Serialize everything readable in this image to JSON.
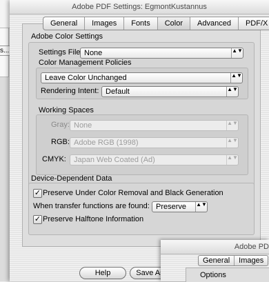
{
  "background": {
    "button_label": "s..."
  },
  "dialog": {
    "title": "Adobe PDF Settings: EgmontKustannus",
    "tabs": [
      {
        "label": "General"
      },
      {
        "label": "Images"
      },
      {
        "label": "Fonts"
      },
      {
        "label": "Color"
      },
      {
        "label": "Advanced"
      },
      {
        "label": "PDF/X"
      }
    ],
    "active_tab": "Color"
  },
  "color_settings": {
    "section_title": "Adobe Color Settings",
    "settings_file_label": "Settings File:",
    "settings_file_value": "None",
    "management_title": "Color Management Policies",
    "policy_value": "Leave Color Unchanged",
    "rendering_intent_label": "Rendering Intent:",
    "rendering_intent_value": "Default",
    "working_spaces_title": "Working Spaces",
    "gray_label": "Gray:",
    "gray_value": "None",
    "rgb_label": "RGB:",
    "rgb_value": "Adobe RGB (1998)",
    "cmyk_label": "CMYK:",
    "cmyk_value": "Japan Web Coated (Ad)"
  },
  "device_data": {
    "section_title": "Device-Dependent Data",
    "ucr_label": "Preserve Under Color Removal and Black Generation",
    "ucr_checked": true,
    "transfer_label": "When transfer functions are found:",
    "transfer_value": "Preserve",
    "halftone_label": "Preserve Halftone Information",
    "halftone_checked": true
  },
  "buttons": {
    "help": "Help",
    "save_as": "Save As..."
  },
  "overlay_window": {
    "title": "Adobe PD",
    "tabs": [
      {
        "label": "General"
      },
      {
        "label": "Images"
      }
    ],
    "options_label": "Options"
  },
  "glyphs": {
    "check": "✓",
    "popup_arrows": "▲▼"
  }
}
